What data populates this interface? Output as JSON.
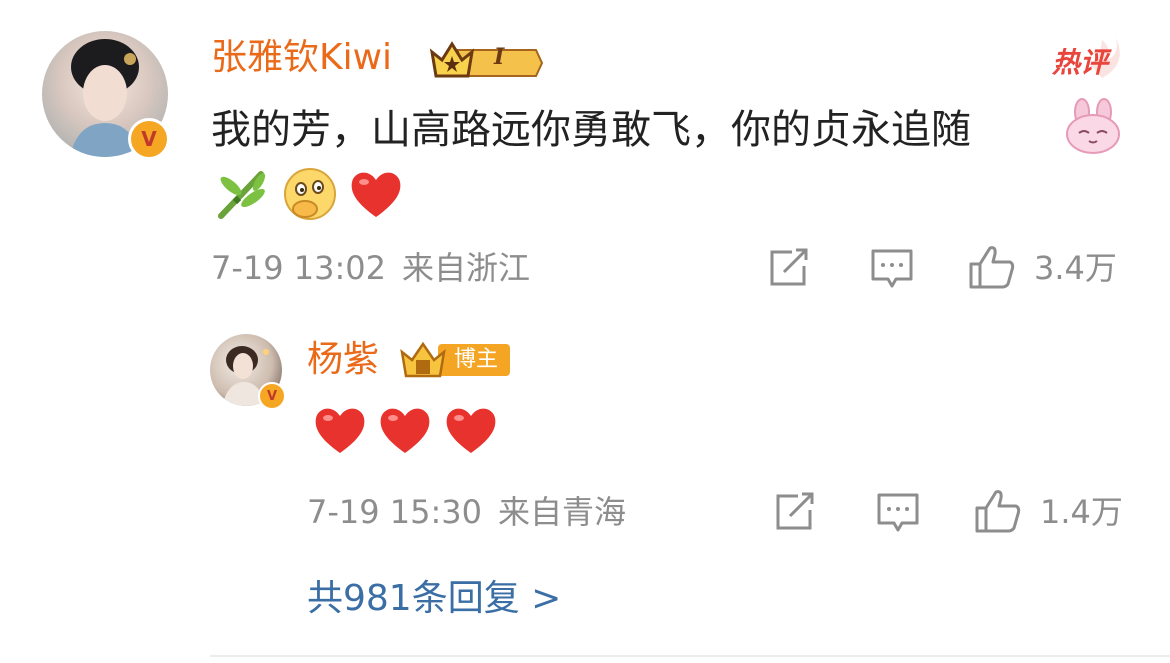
{
  "comments": [
    {
      "username": "张雅钦Kiwi",
      "level_badge": "I",
      "hot_tag": "热评",
      "text": "我的芳，山高路远你勇敢飞，你的贞永追随",
      "timestamp": "7-19 13:02",
      "location": "来自浙江",
      "likes": "3.4万",
      "verified_mark": "V"
    }
  ],
  "reply": {
    "username": "杨紫",
    "role_badge": "博主",
    "timestamp": "7-19 15:30",
    "location": "来自青海",
    "likes": "1.4万",
    "verified_mark": "V"
  },
  "more_replies": "共981条回复 >",
  "colors": {
    "username": "#ea6a1a",
    "meta": "#8d8d8d",
    "link": "#3a6ea5",
    "hot_tag": "#e8453c",
    "heart": "#e8322d"
  },
  "icons": [
    "share-icon",
    "comment-icon",
    "like-icon",
    "heart-emoji",
    "bamboo-emoji",
    "thinking-emoji",
    "bunny-emoji"
  ]
}
